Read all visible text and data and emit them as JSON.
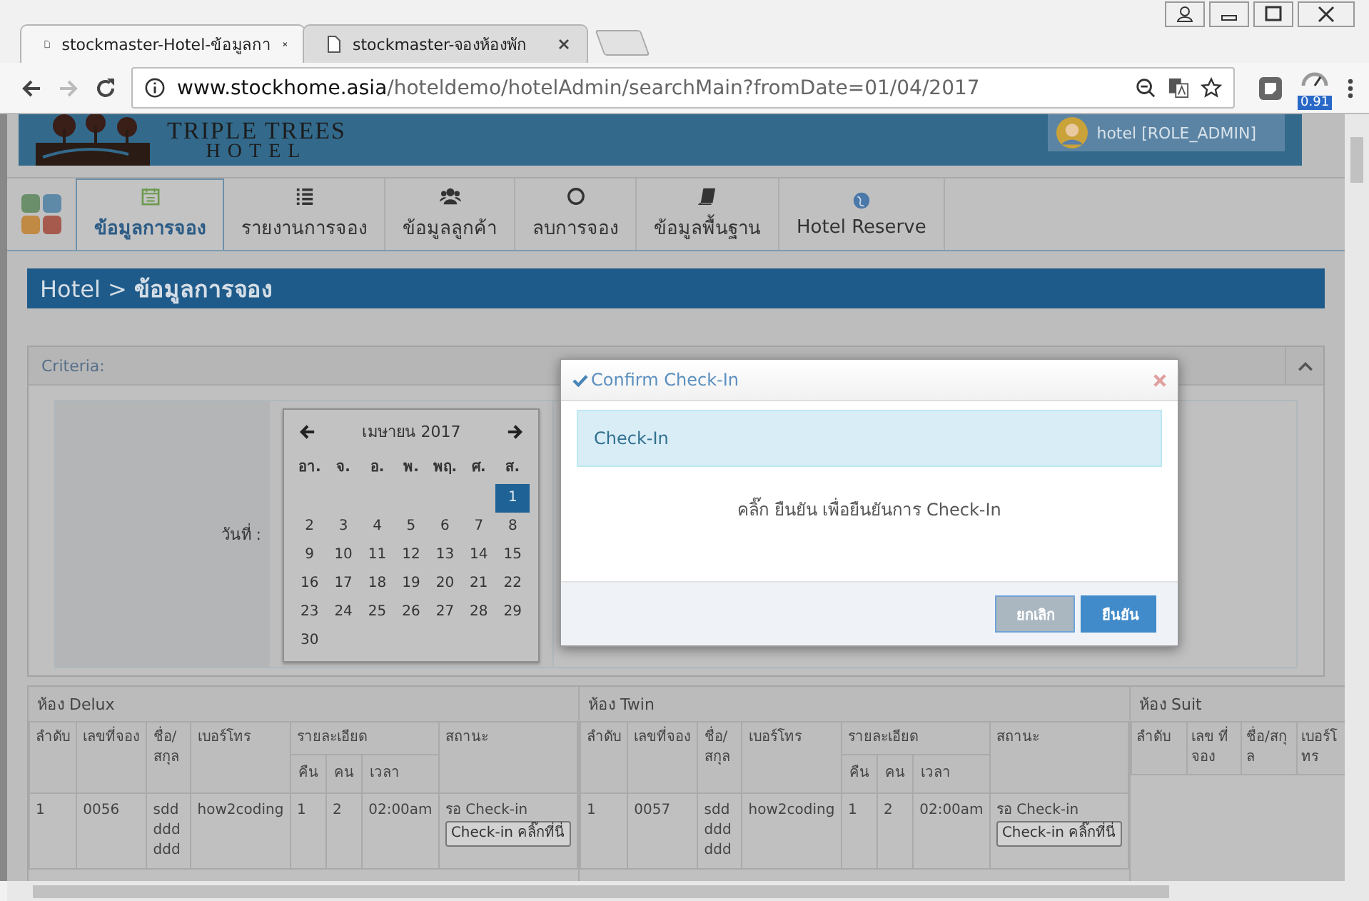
{
  "browser": {
    "tabs": [
      {
        "title": "stockmaster-Hotel-ข้อมูลกา",
        "selected": true
      },
      {
        "title": "stockmaster-จองห้องพัก",
        "selected": false
      }
    ],
    "url_host": "www.stockhome.asia",
    "url_path": "/hoteldemo/hotelAdmin/searchMain?fromDate=01/04/2017",
    "extension_badge": "0.91"
  },
  "header": {
    "logo_line_1": "TRIPLE TREES",
    "logo_line_2": "HOTEL",
    "user": "hotel [ROLE_ADMIN]"
  },
  "nav": {
    "items": [
      {
        "label": "ข้อมูลการจอง",
        "selected": true
      },
      {
        "label": "รายงานการจอง",
        "selected": false
      },
      {
        "label": "ข้อมูลลูกค้า",
        "selected": false
      },
      {
        "label": "ลบการจอง",
        "selected": false
      },
      {
        "label": "ข้อมูลพื้นฐาน",
        "selected": false
      },
      {
        "label": "Hotel Reserve",
        "selected": false
      }
    ]
  },
  "breadcrumb": "Hotel > **ข้อมูลการจอง**",
  "criteria": {
    "title": "Criteria:",
    "date_label": "วันที่ :",
    "calendar": {
      "title": "เมษายน 2017",
      "weekdays": [
        "อา.",
        "จ.",
        "อ.",
        "พ.",
        "พฤ.",
        "ศ.",
        "ส."
      ],
      "weeks": [
        [
          {
            "kind": "blank"
          },
          {
            "kind": "blank"
          },
          {
            "kind": "blank"
          },
          {
            "kind": "blank"
          },
          {
            "kind": "blank"
          },
          {
            "kind": "blank"
          },
          {
            "kind": "day",
            "label": "1",
            "selected": true
          }
        ],
        [
          {
            "kind": "day",
            "label": "2",
            "selected": false
          },
          {
            "kind": "day",
            "label": "3",
            "selected": false
          },
          {
            "kind": "day",
            "label": "4",
            "selected": false
          },
          {
            "kind": "day",
            "label": "5",
            "selected": false
          },
          {
            "kind": "day",
            "label": "6",
            "selected": false
          },
          {
            "kind": "day",
            "label": "7",
            "selected": false
          },
          {
            "kind": "day",
            "label": "8",
            "selected": false
          }
        ],
        [
          {
            "kind": "day",
            "label": "9",
            "selected": false
          },
          {
            "kind": "day",
            "label": "10",
            "selected": false
          },
          {
            "kind": "day",
            "label": "11",
            "selected": false
          },
          {
            "kind": "day",
            "label": "12",
            "selected": false
          },
          {
            "kind": "day",
            "label": "13",
            "selected": false
          },
          {
            "kind": "day",
            "label": "14",
            "selected": false
          },
          {
            "kind": "day",
            "label": "15",
            "selected": false
          }
        ],
        [
          {
            "kind": "day",
            "label": "16",
            "selected": false
          },
          {
            "kind": "day",
            "label": "17",
            "selected": false
          },
          {
            "kind": "day",
            "label": "18",
            "selected": false
          },
          {
            "kind": "day",
            "label": "19",
            "selected": false
          },
          {
            "kind": "day",
            "label": "20",
            "selected": false
          },
          {
            "kind": "day",
            "label": "21",
            "selected": false
          },
          {
            "kind": "day",
            "label": "22",
            "selected": false
          }
        ],
        [
          {
            "kind": "day",
            "label": "23",
            "selected": false
          },
          {
            "kind": "day",
            "label": "24",
            "selected": false
          },
          {
            "kind": "day",
            "label": "25",
            "selected": false
          },
          {
            "kind": "day",
            "label": "26",
            "selected": false
          },
          {
            "kind": "day",
            "label": "27",
            "selected": false
          },
          {
            "kind": "day",
            "label": "28",
            "selected": false
          },
          {
            "kind": "day",
            "label": "29",
            "selected": false
          }
        ],
        [
          {
            "kind": "day",
            "label": "30",
            "selected": false
          }
        ]
      ]
    }
  },
  "table": {
    "groups": [
      {
        "title": "ห้อง Delux",
        "columns": [
          {
            "label": "ลำดับ"
          },
          {
            "label": "เลขที่จอง"
          },
          {
            "label": "ชื่อ/สกุล"
          },
          {
            "label": "เบอร์โทร"
          },
          {
            "label": "รายละเอียด",
            "colspan": 3,
            "children": [
              "คืน",
              "คน",
              "เวลา"
            ]
          },
          {
            "label": "สถานะ"
          }
        ],
        "rows": [
          {
            "cells": [
              "1",
              "0056",
              "sdd ddd ddd",
              "how2coding",
              "1",
              "2",
              "02:00am"
            ],
            "status": "รอ Check-in",
            "action": "Check-in คลิ๊กที่นี่"
          }
        ]
      },
      {
        "title": "ห้อง Twin",
        "columns": [
          {
            "label": "ลำดับ"
          },
          {
            "label": "เลขที่จอง"
          },
          {
            "label": "ชื่อ/สกุล"
          },
          {
            "label": "เบอร์โทร"
          },
          {
            "label": "รายละเอียด",
            "colspan": 3,
            "children": [
              "คืน",
              "คน",
              "เวลา"
            ]
          },
          {
            "label": "สถานะ"
          }
        ],
        "rows": [
          {
            "cells": [
              "1",
              "0057",
              "sdd ddd ddd",
              "how2coding",
              "1",
              "2",
              "02:00am"
            ],
            "status": "รอ Check-in",
            "action": "Check-in คลิ๊กที่นี่"
          }
        ]
      },
      {
        "title": "ห้อง Suit",
        "columns": [
          {
            "label": "ลำดับ"
          },
          {
            "label": "เลข ที่ จอง"
          },
          {
            "label": "ชื่อ/สกุล"
          },
          {
            "label": "เบอร์โทร"
          }
        ]
      }
    ]
  },
  "dialog": {
    "title": "Confirm Check-In",
    "alert": "Check-In",
    "message": "คลิ๊ก ยืนยัน เพื่อยืนยันการ Check-In",
    "buttons": [
      {
        "label": "ยกเลิก",
        "kind": "cancel"
      },
      {
        "label": "ยืนยัน",
        "kind": "confirm"
      }
    ]
  }
}
